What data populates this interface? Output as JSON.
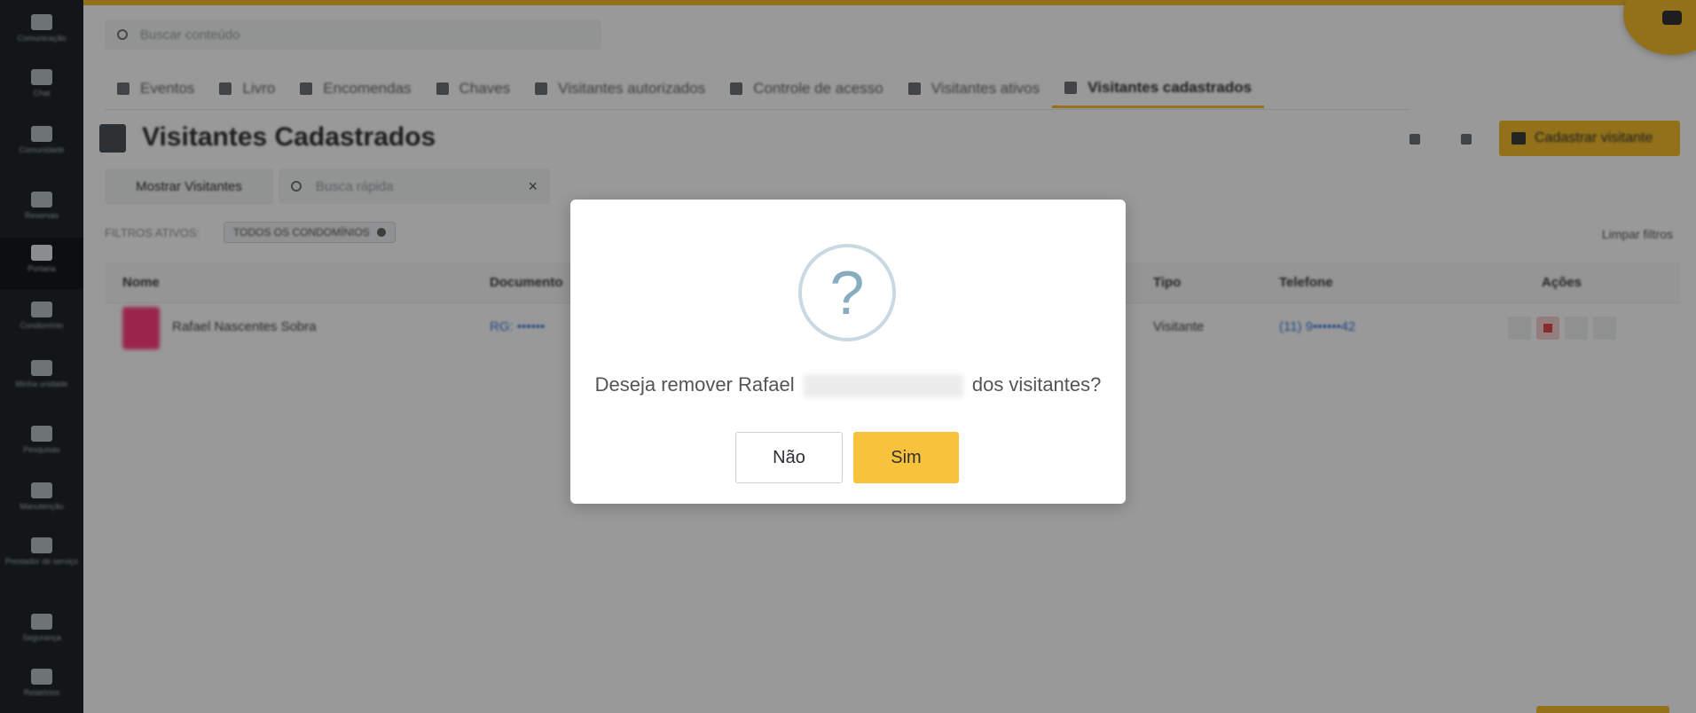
{
  "app": {
    "search_placeholder": "Buscar conteúdo"
  },
  "sidebar": {
    "items": [
      {
        "label": "Comunicação",
        "icon": "megaphone-icon"
      },
      {
        "label": "Chat",
        "icon": "chat-icon"
      },
      {
        "label": "Comunidade",
        "icon": "share-icon"
      },
      {
        "label": "Reservas",
        "icon": "calendar-icon"
      },
      {
        "label": "Portaria",
        "icon": "door-icon"
      },
      {
        "label": "Condomínio",
        "icon": "building-icon"
      },
      {
        "label": "Minha unidade",
        "icon": "home-icon"
      },
      {
        "label": "Pesquisas",
        "icon": "survey-icon"
      },
      {
        "label": "Manutenção",
        "icon": "wrench-icon"
      },
      {
        "label": "Prestador de serviço",
        "icon": "tools-icon"
      },
      {
        "label": "Segurança",
        "icon": "shield-icon"
      },
      {
        "label": "Relatórios",
        "icon": "report-icon"
      }
    ]
  },
  "tabs": [
    {
      "label": "Eventos",
      "icon": "event-icon"
    },
    {
      "label": "Livro",
      "icon": "book-icon"
    },
    {
      "label": "Encomendas",
      "icon": "package-icon"
    },
    {
      "label": "Chaves",
      "icon": "key-icon"
    },
    {
      "label": "Visitantes autorizados",
      "icon": "id-card-icon"
    },
    {
      "label": "Controle de acesso",
      "icon": "access-icon"
    },
    {
      "label": "Visitantes ativos",
      "icon": "badge-icon"
    },
    {
      "label": "Visitantes cadastrados",
      "icon": "person-badge-icon",
      "active": true
    }
  ],
  "page": {
    "title": "Visitantes Cadastrados",
    "primary_button": "Cadastrar visitante",
    "show_button": "Mostrar Visitantes",
    "filter_placeholder": "Busca rápida",
    "filters_label": "FILTROS ATIVOS:",
    "filter_chip": "TODOS OS CONDOMÍNIOS",
    "clear_filters": "Limpar filtros"
  },
  "table": {
    "headers": [
      "Nome",
      "Documento",
      "Tipo",
      "Telefone",
      "Ações"
    ],
    "rows": [
      {
        "name": "Rafael Nascentes Sobra",
        "document": "RG: ••••••",
        "type": "Visitante",
        "phone": "(11) 9••••••42"
      }
    ]
  },
  "modal": {
    "icon_glyph": "?",
    "message_before": "Deseja remover Rafael",
    "message_after": "dos visitantes?",
    "no_label": "Não",
    "yes_label": "Sim"
  },
  "colors": {
    "accent": "#f5bd2c",
    "confirm_button": "#f9c23c",
    "question_icon": "#87adbf",
    "sidebar_bg": "#1e2528"
  }
}
